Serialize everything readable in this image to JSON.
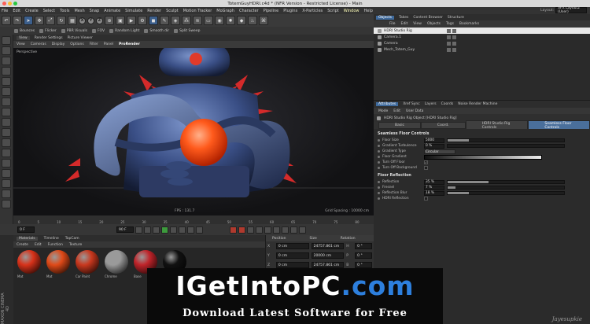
{
  "window": {
    "title": "TotemGuyHDRI.c4d * (NFR Version - Restricted License) - Main"
  },
  "menubar": [
    "File",
    "Edit",
    "Create",
    "Select",
    "Tools",
    "Mesh",
    "Snap",
    "Animate",
    "Simulate",
    "Render",
    "Sculpt",
    "Motion Tracker",
    "MoGraph",
    "Character",
    "Pipeline",
    "Plugins",
    "X-Particles",
    "Script",
    "Window",
    "Help"
  ],
  "toolbar": {
    "axes": [
      "X",
      "Y",
      "Z"
    ],
    "presets": [
      "Bounces",
      "Flicker",
      "PBR Visuals",
      "FOV",
      "Random Light",
      "Smooth dir",
      "Split Sweep"
    ]
  },
  "viewport": {
    "tabs": [
      "View",
      "Render Settings",
      "Picture Viewer"
    ],
    "menu": [
      "View",
      "Cameras",
      "Display",
      "Options",
      "Filter",
      "Panel",
      "ProRender"
    ],
    "selected_menu": "ProRender",
    "label": "Perspective",
    "grid_spacing": "Grid Spacing : 10000 cm",
    "fps": "FPS : 131.7"
  },
  "timeline": {
    "ticks": [
      "0",
      "5",
      "10",
      "15",
      "20",
      "25",
      "30",
      "35",
      "40",
      "45",
      "50",
      "55",
      "60",
      "65",
      "70",
      "75",
      "80",
      "85",
      "90"
    ]
  },
  "transport": {
    "current_frame": "0 F",
    "start_field": "0 F",
    "end_field": "90 F"
  },
  "materials": {
    "tabs": [
      "Materials",
      "Timeline",
      "TopCam"
    ],
    "menu": [
      "Create",
      "Edit",
      "Function",
      "Texture"
    ],
    "items": [
      {
        "label": "Mat",
        "color": "#d8321a"
      },
      {
        "label": "Mat",
        "color": "#e04a18"
      },
      {
        "label": "Car Paint",
        "color": "#c9381e"
      },
      {
        "label": "Chrome",
        "color": "#9a9a9a"
      },
      {
        "label": "Base",
        "color": "#c0242a"
      },
      {
        "label": "Mat",
        "color": "#111111"
      }
    ]
  },
  "coords": {
    "headers": [
      "Position",
      "Size",
      "Rotation"
    ],
    "rows": [
      {
        "axis": "X",
        "pos": "0 cm",
        "size": "24757.861 cm",
        "rot_label": "H",
        "rot": "0 °"
      },
      {
        "axis": "Y",
        "pos": "0 cm",
        "size": "20000 cm",
        "rot_label": "P",
        "rot": "0 °"
      },
      {
        "axis": "Z",
        "pos": "0 cm",
        "size": "24757.861 cm",
        "rot_label": "B",
        "rot": "0 °"
      }
    ],
    "mode": "Object (Rel)",
    "size_mode": "Size",
    "apply": "Apply"
  },
  "objects": {
    "tabs": [
      "Objects",
      "Takes",
      "Content Browser",
      "Structure"
    ],
    "menu": [
      "File",
      "Edit",
      "View",
      "Objects",
      "Tags",
      "Bookmarks"
    ],
    "layout_label": "Layout:",
    "layout_value": "SFX Layout2 (User)",
    "list": [
      {
        "name": "HDRI Studio Rig",
        "selected": true
      },
      {
        "name": "Camera.1",
        "selected": false
      },
      {
        "name": "Camera",
        "selected": false
      },
      {
        "name": "Mech_Totem_Guy",
        "selected": false
      }
    ]
  },
  "attributes": {
    "tabs": [
      "Attributes",
      "Xref Sync",
      "Layers",
      "Coords",
      "Noise Render Machine"
    ],
    "menu": [
      "Mode",
      "Edit",
      "User Data"
    ],
    "title": "HDRI Studio Rig Object [HDRI Studio Rig]",
    "subtabs": [
      "Basic",
      "Coord.",
      "HDRI Studio Rig Controls",
      "Seamless Floor Controls"
    ],
    "active_subtab": "Seamless Floor Controls",
    "section1": "Seamless Floor Controls",
    "params1": [
      {
        "label": "Floor Size",
        "value": "5000",
        "fill": 0.18
      },
      {
        "label": "Gradient Turbulence",
        "value": "0 %",
        "fill": 0.0
      },
      {
        "label": "Gradient Type",
        "value": "Circular",
        "kind": "dropdown"
      },
      {
        "label": "Floor Gradient",
        "kind": "gradient"
      },
      {
        "label": "Turn Off Floor",
        "value": "✓",
        "kind": "check"
      },
      {
        "label": "Turn Off Background",
        "value": "",
        "kind": "check"
      }
    ],
    "section2": "Floor Reflection",
    "params2": [
      {
        "label": "Reflection",
        "value": "35 %",
        "fill": 0.35
      },
      {
        "label": "Fresnel",
        "value": "7 %",
        "fill": 0.07
      },
      {
        "label": "Reflection Blur",
        "value": "18 %",
        "fill": 0.18
      },
      {
        "label": "HDRI Reflection",
        "value": "",
        "kind": "check"
      }
    ]
  },
  "branding": {
    "maxon": "MAXON CINEMA 4D",
    "watermark": "Jayesupkie"
  },
  "banner": {
    "part1": "IGetIntoPC",
    "part2": ".com",
    "subtitle": "Download Latest Software for Free"
  }
}
